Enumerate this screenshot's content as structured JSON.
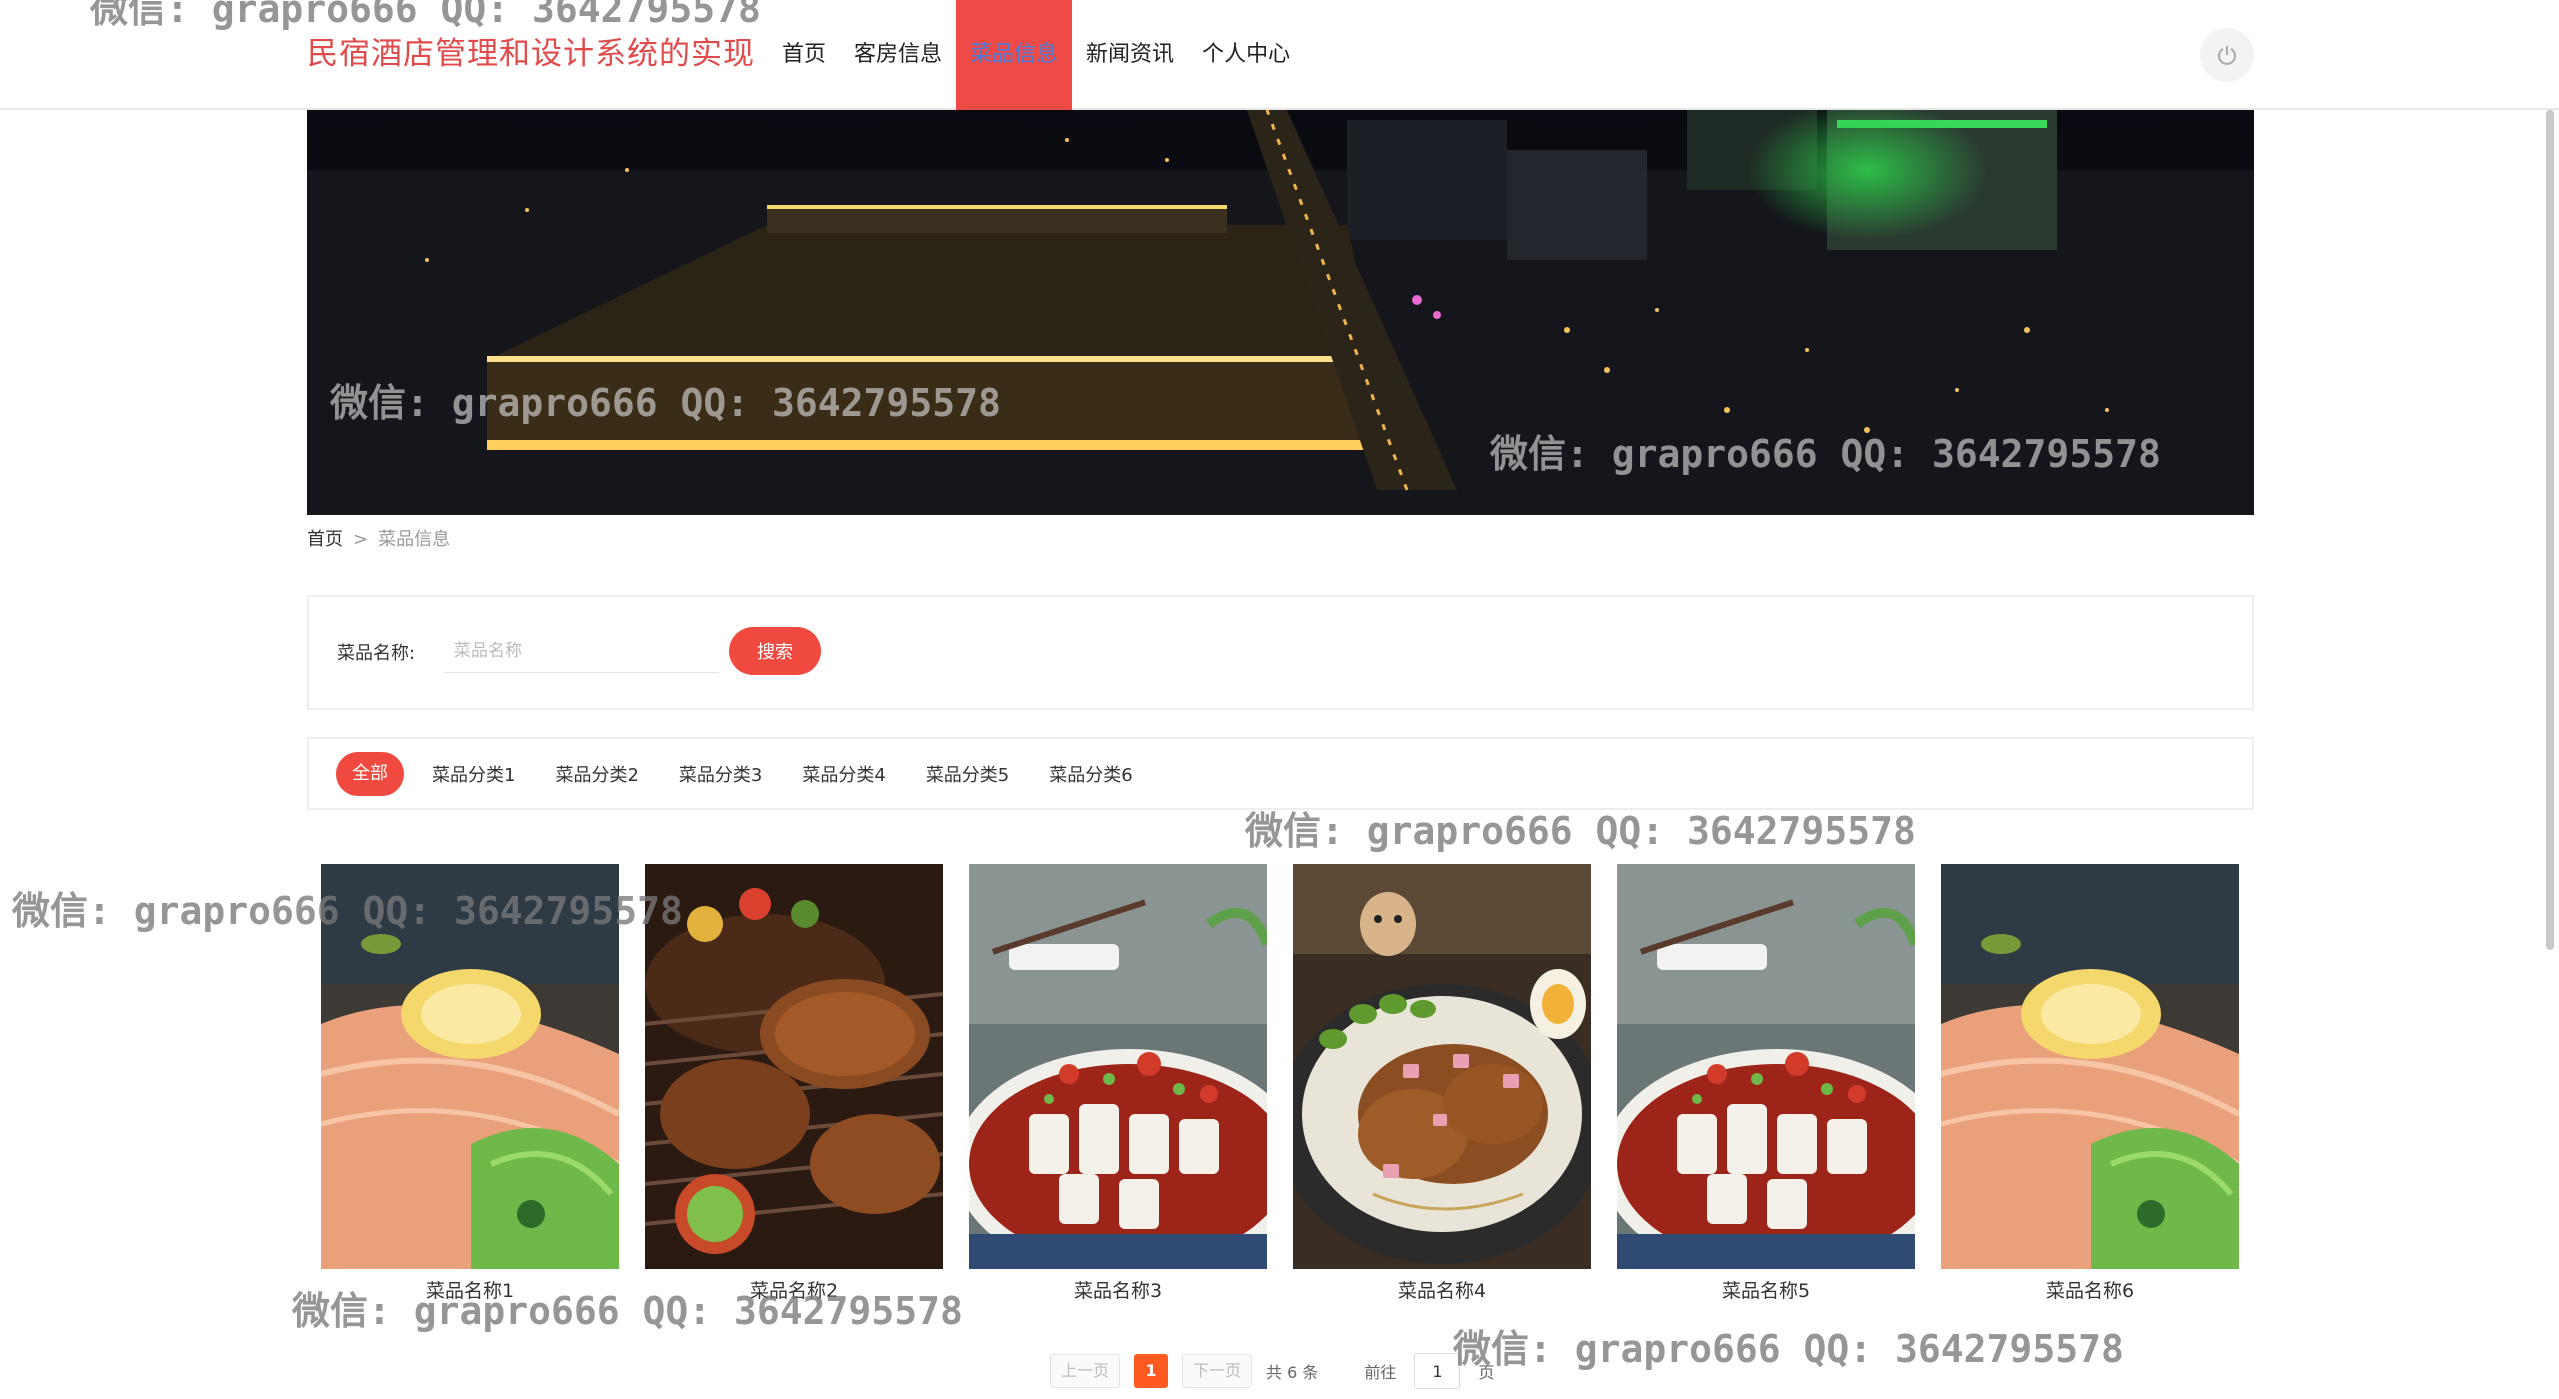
{
  "header": {
    "site_title": "民宿酒店管理和设计系统的实现",
    "nav": [
      "首页",
      "客房信息",
      "菜品信息",
      "新闻资讯",
      "个人中心"
    ],
    "active_nav": "菜品信息",
    "power_icon": "power-icon"
  },
  "breadcrumb": {
    "home": "首页",
    "separator": ">",
    "current": "菜品信息"
  },
  "search": {
    "label": "菜品名称:",
    "placeholder": "菜品名称",
    "value": "",
    "button": "搜索"
  },
  "categories": [
    "全部",
    "菜品分类1",
    "菜品分类2",
    "菜品分类3",
    "菜品分类4",
    "菜品分类5",
    "菜品分类6"
  ],
  "products": [
    {
      "name": "菜品名称1",
      "image": "salmon-dish"
    },
    {
      "name": "菜品名称2",
      "image": "grilled-meat-dish"
    },
    {
      "name": "菜品名称3",
      "image": "noodle-dish"
    },
    {
      "name": "菜品名称4",
      "image": "braised-pork-dish"
    },
    {
      "name": "菜品名称5",
      "image": "noodle-dish"
    },
    {
      "name": "菜品名称6",
      "image": "salmon-dish"
    }
  ],
  "pagination": {
    "prev": "上一页",
    "current": "1",
    "next": "下一页",
    "total_text": "共 6 条",
    "goto_label": "前往",
    "goto_value": "1",
    "page_suffix": "页"
  },
  "watermark_text": "微信: grapro666 QQ: 3642795578",
  "colors": {
    "accent": "#f0493f",
    "title": "#e14b4b",
    "page_active": "#ff5a1f"
  }
}
